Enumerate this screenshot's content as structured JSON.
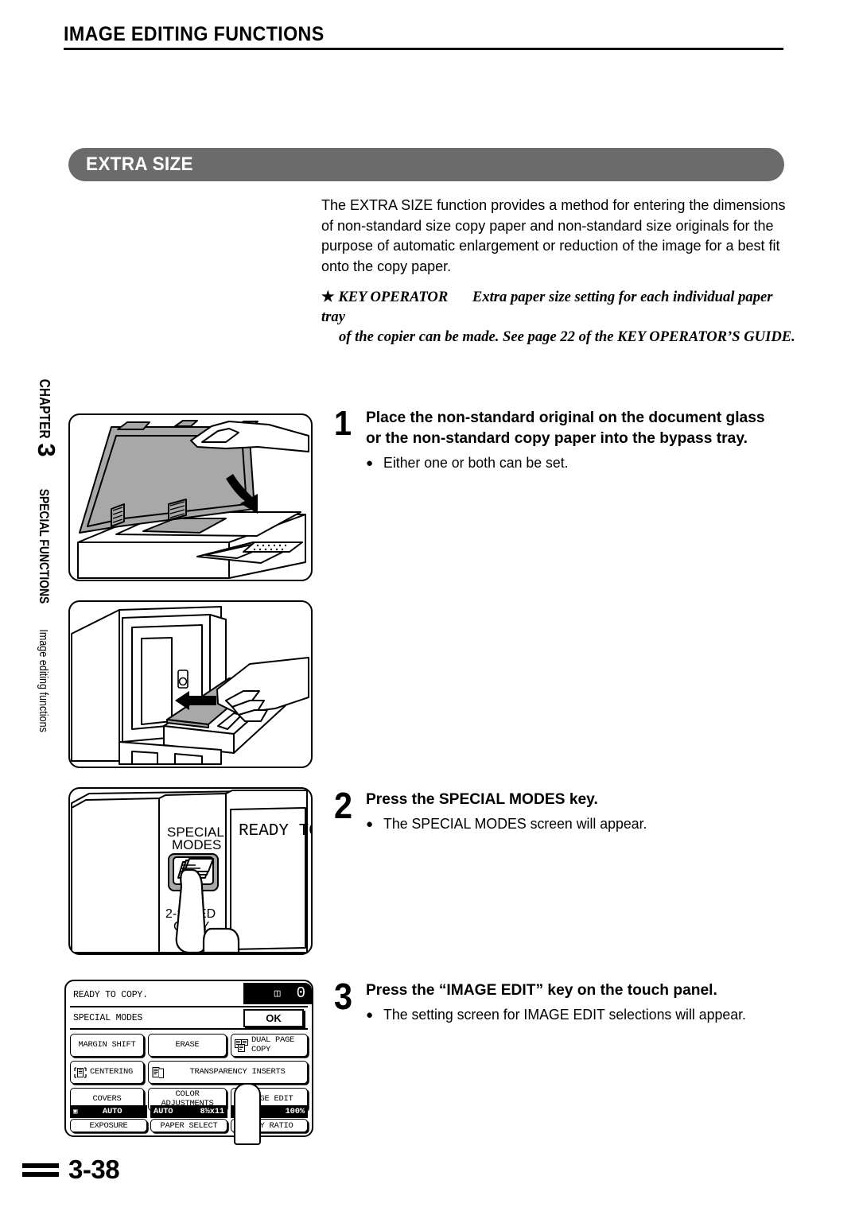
{
  "header": {
    "title": "IMAGE EDITING FUNCTIONS"
  },
  "section": {
    "label": "EXTRA SIZE"
  },
  "intro": {
    "paragraph": "The EXTRA SIZE function provides a method for entering the dimensions of non-standard size copy paper and non-standard size originals for the purpose of automatic enlargement or reduction of the image for a best fit onto the copy paper.",
    "key_operator": {
      "star": "★",
      "label": "KEY OPERATOR",
      "line1": "Extra paper size setting for each individual paper tray",
      "line2": "of the copier can be made. See page 22 of the KEY OPERATOR’S GUIDE."
    }
  },
  "chapter_rail": {
    "word": "CHAPTER",
    "number": "3",
    "subtitle": "SPECIAL FUNCTIONS",
    "subtitle2": "Image editing functions"
  },
  "steps": [
    {
      "number": "1",
      "heading_line1": "Place the non-standard original on the document glass",
      "heading_line2": "or the non-standard copy paper into the bypass tray.",
      "bullet": "Either one or both can be set.",
      "bullet_dot": "●"
    },
    {
      "number": "2",
      "heading_line1": "Press the SPECIAL MODES key.",
      "heading_line2": "",
      "bullet": "The SPECIAL MODES screen will appear.",
      "bullet_dot": "●"
    },
    {
      "number": "3",
      "heading_line1": "Press the “IMAGE EDIT” key on the touch panel.",
      "heading_line2": "",
      "bullet": "The setting screen for IMAGE EDIT selections will appear.",
      "bullet_dot": "●"
    }
  ],
  "illustrations": {
    "doc_glass": "document-glass-open-lid-illustration",
    "bypass_tray": "bypass-tray-paper-loading-illustration",
    "special_modes_key": {
      "caption_key": "SPECIAL\nMODES",
      "key_label_line1": "SPECIAL",
      "key_label_line2": "MODES",
      "display_text": "READY TO",
      "other_key_line1": "2-SIDED",
      "other_key_line2": "COPY"
    }
  },
  "touch_panel": {
    "status_text": "READY TO COPY.",
    "copy_count": "0",
    "tray_icon": "paper-tray-icon",
    "mode_label": "SPECIAL MODES",
    "ok_label": "OK",
    "keys_row1": [
      {
        "label": "MARGIN SHIFT",
        "icon": ""
      },
      {
        "label": "ERASE",
        "icon": ""
      },
      {
        "label_line1": "DUAL PAGE",
        "label_line2": "COPY",
        "icon": "dual-page-copy-icon"
      }
    ],
    "keys_row2": [
      {
        "label": "CENTERING",
        "icon": "centering-icon"
      },
      {
        "label": "TRANSPARENCY INSERTS",
        "icon": "transparency-inserts-icon"
      }
    ],
    "keys_row3": [
      {
        "label": "COVERS",
        "icon": ""
      },
      {
        "label_line1": "COLOR",
        "label_line2": "ADJUSTMENTS",
        "icon": ""
      },
      {
        "label": "IMAGE EDIT",
        "icon": ""
      }
    ],
    "status_strip": [
      {
        "value": "AUTO",
        "value2": "",
        "name": "EXPOSURE",
        "icon": "exposure-icon"
      },
      {
        "value": "AUTO",
        "value2": "8½x11",
        "name": "PAPER SELECT",
        "icon": ""
      },
      {
        "value": "100",
        "value2": "%",
        "name": "COPY RATIO",
        "icon": ""
      }
    ],
    "finger": "pointing-finger-overlay"
  },
  "footer": {
    "page_number": "3-38"
  },
  "colors": {
    "band": "#6b6b6b",
    "ink": "#000000",
    "paper": "#ffffff",
    "illustration_fill": "#a8a8a8"
  }
}
